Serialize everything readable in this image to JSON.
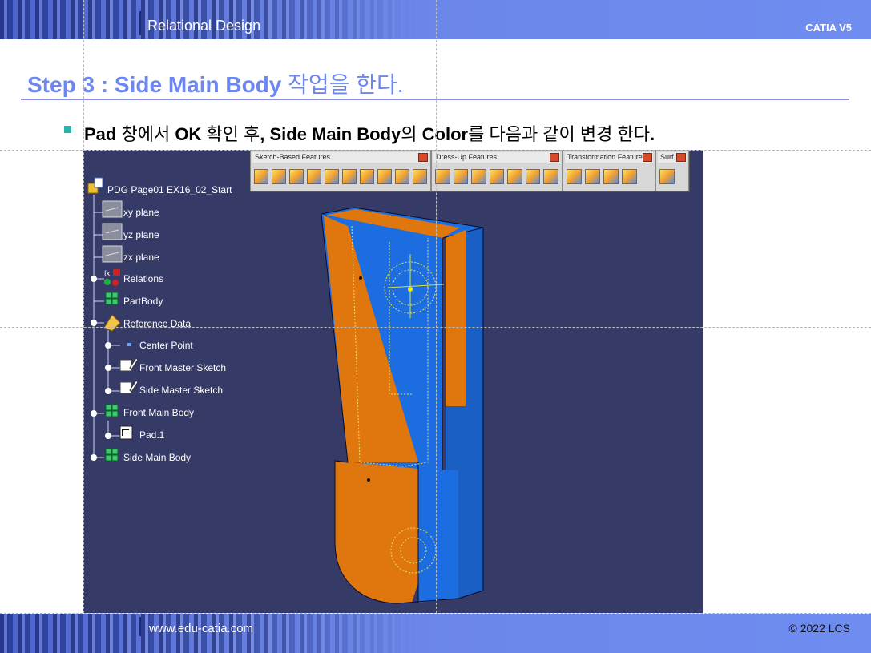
{
  "header": {
    "title": "Relational Design",
    "brand": "CATIA V5"
  },
  "step": {
    "title_prefix": "Step 3 : Side Main Body",
    "title_suffix": " 작업을 한다."
  },
  "instruction": {
    "p1_bold": "Pad",
    "p2": " 창에서 ",
    "p3_bold": "OK",
    "p4": " 확인 후",
    "p5_bold": ", Side Main Body",
    "p6": "의 ",
    "p7_bold": "Color",
    "p8": "를 다음과 같이 변경 한다",
    "p9_bold": "."
  },
  "toolbars": [
    {
      "title": "Sketch-Based Features",
      "icon_count": 10
    },
    {
      "title": "Dress-Up Features",
      "icon_count": 7
    },
    {
      "title": "Transformation Features",
      "icon_count": 4
    },
    {
      "title": "Surf...",
      "icon_count": 1
    }
  ],
  "tree": {
    "root": "PDG Page01 EX16_02_Start",
    "items": [
      "xy plane",
      "yz plane",
      "zx plane",
      "Relations",
      "PartBody",
      "Reference Data",
      "Center Point",
      "Front Master Sketch",
      "Side Master Sketch",
      "Front Main Body",
      "Pad.1",
      "Side Main Body"
    ]
  },
  "colors": {
    "accent": "#6d86f0",
    "viewport_bg": "#353a66",
    "body_blue": "#1c6ee0",
    "body_orange": "#e0770e"
  },
  "footer": {
    "url": "www.edu-catia.com",
    "copyright": "© 2022 LCS"
  }
}
